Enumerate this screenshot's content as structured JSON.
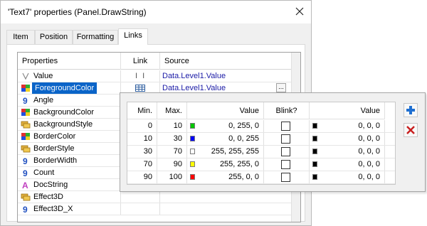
{
  "window": {
    "title": "'Text7' properties (Panel.DrawString)"
  },
  "tabs": [
    {
      "label": "Item"
    },
    {
      "label": "Position"
    },
    {
      "label": "Formatting"
    },
    {
      "label": "Links",
      "active": true
    }
  ],
  "links_grid": {
    "headers": {
      "properties": "Properties",
      "link": "Link",
      "source": "Source"
    },
    "rows": [
      {
        "name": "Value",
        "icon": "value-icon",
        "link_icon": "text-cursor-icon",
        "source": "Data.Level1.Value"
      },
      {
        "name": "ForegroundColor",
        "icon": "color-icon",
        "link_icon": "table-link-icon",
        "source": "Data.Level1.Value",
        "selected": true
      },
      {
        "name": "Angle",
        "icon": "number-icon",
        "link_icon": "",
        "source": ""
      },
      {
        "name": "BackgroundColor",
        "icon": "color-icon",
        "link_icon": "",
        "source": ""
      },
      {
        "name": "BackgroundStyle",
        "icon": "style-icon",
        "link_icon": "",
        "source": ""
      },
      {
        "name": "BorderColor",
        "icon": "color-icon",
        "link_icon": "",
        "source": ""
      },
      {
        "name": "BorderStyle",
        "icon": "style-icon",
        "link_icon": "",
        "source": ""
      },
      {
        "name": "BorderWidth",
        "icon": "number-icon",
        "link_icon": "",
        "source": ""
      },
      {
        "name": "Count",
        "icon": "number-icon",
        "link_icon": "",
        "source": ""
      },
      {
        "name": "DocString",
        "icon": "text-icon",
        "link_icon": "",
        "source": ""
      },
      {
        "name": "Effect3D",
        "icon": "style-icon",
        "link_icon": "",
        "source": ""
      },
      {
        "name": "Effect3D_X",
        "icon": "number-icon",
        "link_icon": "",
        "source": ""
      }
    ]
  },
  "color_table": {
    "headers": {
      "min": "Min.",
      "max": "Max.",
      "value": "Value",
      "blink": "Blink?",
      "blink_value": "Value"
    },
    "rows": [
      {
        "min": "0",
        "max": "10",
        "value": "0, 255, 0",
        "color": "#00c800",
        "blink": false,
        "blink_value": "0, 0, 0",
        "blink_color": "#000000"
      },
      {
        "min": "10",
        "max": "30",
        "value": "0, 0, 255",
        "color": "#0000ff",
        "blink": false,
        "blink_value": "0, 0, 0",
        "blink_color": "#000000"
      },
      {
        "min": "30",
        "max": "70",
        "value": "255, 255, 255",
        "color": "#ffffff",
        "blink": false,
        "blink_value": "0, 0, 0",
        "blink_color": "#000000"
      },
      {
        "min": "70",
        "max": "90",
        "value": "255, 255, 0",
        "color": "#ffff00",
        "blink": false,
        "blink_value": "0, 0, 0",
        "blink_color": "#000000"
      },
      {
        "min": "90",
        "max": "100",
        "value": "255, 0, 0",
        "color": "#ff0000",
        "blink": false,
        "blink_value": "0, 0, 0",
        "blink_color": "#000000"
      }
    ],
    "add_icon": "plus-icon",
    "remove_icon": "delete-icon"
  },
  "colors": {
    "accent": "#0a64c8",
    "link_text": "#1a1aa6",
    "add": "#1f6fd1",
    "remove": "#c81e1e"
  }
}
